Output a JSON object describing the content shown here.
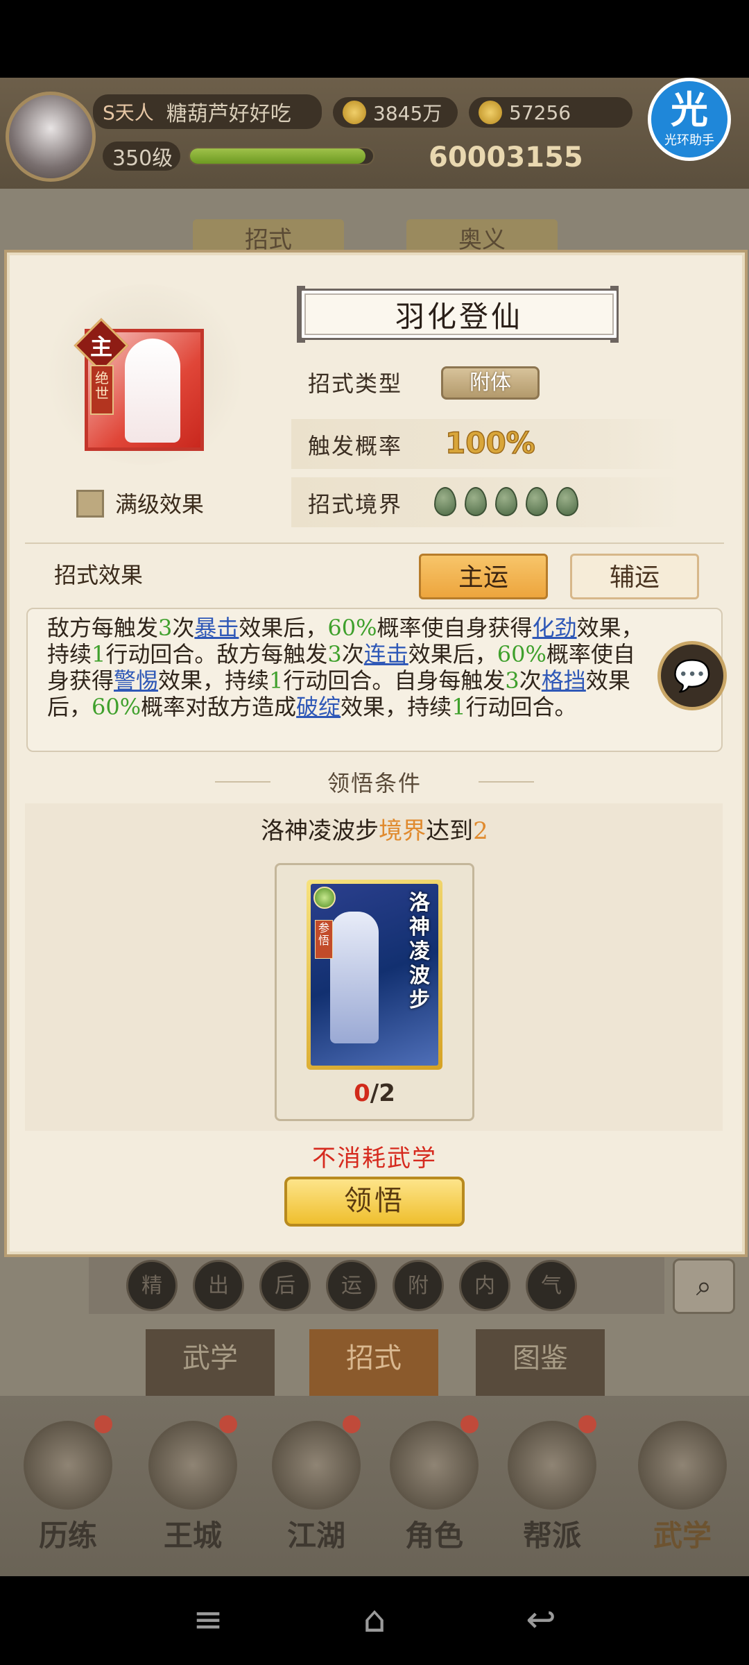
{
  "header": {
    "rank_badge": "S天人",
    "player_name": "糖葫芦好好吃",
    "coins": "3845万",
    "ingots": "57256",
    "level": "350级",
    "level_progress": 0.96,
    "power": "60003155",
    "helper": {
      "icon": "光",
      "label": "光环助手"
    }
  },
  "background_tabs": [
    "招式",
    "奥义"
  ],
  "skill": {
    "name": "羽化登仙",
    "icon_badge": "主",
    "icon_tag": "绝世",
    "max_effect_label": "满级效果",
    "type_label": "招式类型",
    "type_value": "附体",
    "trigger_label": "触发概率",
    "trigger_value": "100%",
    "realm_label": "招式境界",
    "realm_pips": 5,
    "realm_icon": "jade-pip-icon"
  },
  "effect": {
    "label": "招式效果",
    "tab_main": "主运",
    "tab_aux": "辅运",
    "line1": {
      "a": "敌方每触发",
      "n1": "3",
      "b": "次",
      "k1": "暴击",
      "c": "效果后，",
      "p1": "60%",
      "d": "概率使自身获得",
      "k2": "化劲",
      "e": "效果，"
    },
    "line2": {
      "a": "持续",
      "n1": "1",
      "b": "行动回合。敌方每触发",
      "n2": "3",
      "c": "次",
      "k1": "连击",
      "d": "效果后，",
      "p1": "60%",
      "e": "概率使自"
    },
    "line3": {
      "a": "身获得",
      "k1": "警惕",
      "b": "效果，持续",
      "n1": "1",
      "c": "行动回合。自身每触发",
      "n2": "3",
      "d": "次",
      "k2": "格挡",
      "e": "效果"
    },
    "line4": {
      "a": "后，",
      "p1": "60%",
      "b": "概率对敌方造成",
      "k1": "破绽",
      "c": "效果，持续",
      "n1": "1",
      "d": "行动回合。"
    }
  },
  "condition": {
    "title": "领悟条件",
    "text_prefix": "洛神凌波步",
    "text_highlight": "境界",
    "text_mid": "达到",
    "text_value": "2",
    "card_name": "洛神凌波步",
    "card_tag": "参悟",
    "count_have": "0",
    "count_need": "/2",
    "no_consume": "不消耗武学",
    "button": "领悟"
  },
  "filters": [
    "精",
    "出",
    "后",
    "运",
    "附",
    "内",
    "气"
  ],
  "category_tabs": [
    "武学",
    "招式",
    "图鉴"
  ],
  "active_category": "招式",
  "bottom_nav": [
    "历练",
    "王城",
    "江湖",
    "角色",
    "帮派",
    "武学"
  ],
  "colors": {
    "accent_orange": "#eda53d",
    "link_blue": "#2f58b7",
    "value_green": "#3fa02c",
    "warning_red": "#d62a1e"
  }
}
